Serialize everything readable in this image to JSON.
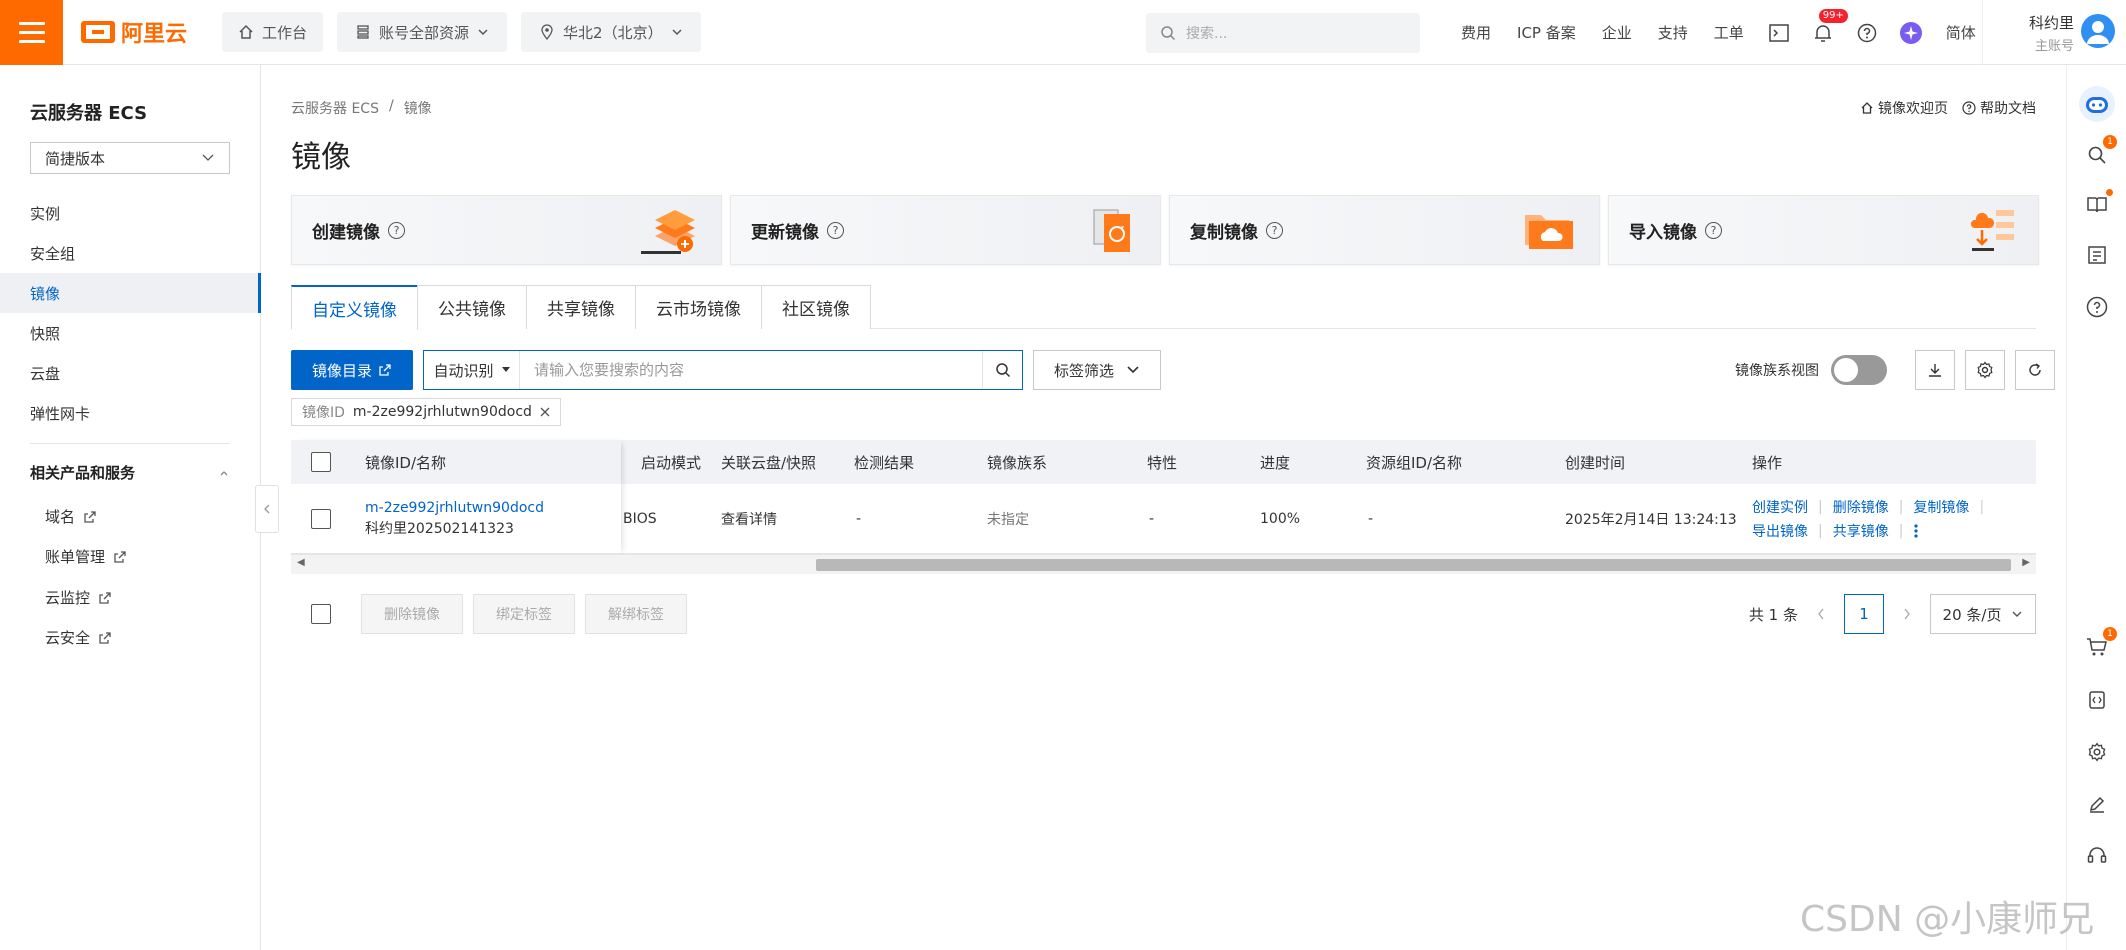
{
  "topbar": {
    "logo_text": "阿里云",
    "workbench": "工作台",
    "resource_scope": "账号全部资源",
    "region": "华北2（北京）",
    "search_placeholder": "搜索...",
    "links": [
      "费用",
      "ICP 备案",
      "企业",
      "支持",
      "工单"
    ],
    "notification_badge": "99+",
    "language": "简体",
    "user_name": "科约里",
    "user_role": "主账号"
  },
  "sidebar": {
    "title": "云服务器 ECS",
    "version_select": "简捷版本",
    "items": [
      {
        "label": "实例"
      },
      {
        "label": "安全组"
      },
      {
        "label": "镜像"
      },
      {
        "label": "快照"
      },
      {
        "label": "云盘"
      },
      {
        "label": "弹性网卡"
      }
    ],
    "related_section": "相关产品和服务",
    "related_items": [
      {
        "label": "域名"
      },
      {
        "label": "账单管理"
      },
      {
        "label": "云监控"
      },
      {
        "label": "云安全"
      }
    ]
  },
  "main": {
    "breadcrumb": [
      "云服务器 ECS",
      "/",
      "镜像"
    ],
    "title": "镜像",
    "header_links": {
      "welcome": "镜像欢迎页",
      "help": "帮助文档"
    },
    "cards": [
      {
        "label": "创建镜像"
      },
      {
        "label": "更新镜像"
      },
      {
        "label": "复制镜像"
      },
      {
        "label": "导入镜像"
      }
    ],
    "tabs": [
      "自定义镜像",
      "公共镜像",
      "共享镜像",
      "云市场镜像",
      "社区镜像"
    ],
    "toolbar": {
      "catalog_button": "镜像目录",
      "search_type": "自动识别",
      "search_placeholder": "请输入您要搜索的内容",
      "tag_filter": "标签筛选",
      "family_view_label": "镜像族系视图"
    },
    "filter_chip": {
      "key": "镜像ID",
      "value": "m-2ze992jrhlutwn90docd"
    },
    "table": {
      "headers": [
        "镜像ID/名称",
        "启动模式",
        "关联云盘/快照",
        "检测结果",
        "镜像族系",
        "特性",
        "进度",
        "资源组ID/名称",
        "创建时间",
        "操作"
      ],
      "rows": [
        {
          "id": "m-2ze992jrhlutwn90docd",
          "name": "科约里202502141323",
          "boot_mode": "BIOS",
          "disk": "查看详情",
          "detect": "-",
          "family": "未指定",
          "feature": "-",
          "progress": "100%",
          "resource_group": "-",
          "created": "2025年2月14日 13:24:13",
          "ops_line1": [
            "创建实例",
            "删除镜像",
            "复制镜像"
          ],
          "ops_line2": [
            "导出镜像",
            "共享镜像"
          ]
        }
      ]
    },
    "batch_buttons": [
      "删除镜像",
      "绑定标签",
      "解绑标签"
    ],
    "pager": {
      "total": "共 1 条",
      "current": "1",
      "page_size": "20 条/页"
    }
  },
  "dock": {
    "search_badge": "1",
    "cart_badge": "1"
  },
  "watermark": "CSDN @小康师兄",
  "colors": {
    "brand": "#ff6a00",
    "primary": "#0064c8"
  }
}
